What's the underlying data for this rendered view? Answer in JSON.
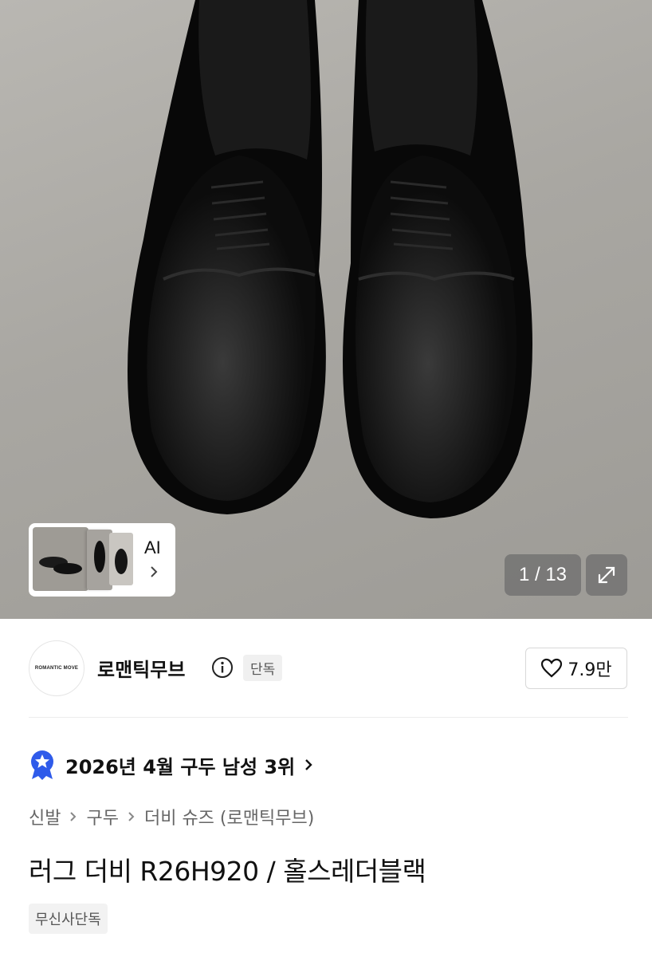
{
  "gallery": {
    "counter_current": "1",
    "counter_sep": " / ",
    "counter_total": "13",
    "ai_label": "AI"
  },
  "brand": {
    "logo_text": "ROMANTIC MOVE",
    "name": "로맨틱무브",
    "exclusive_badge": "단독",
    "like_count": "7.9만"
  },
  "ranking": {
    "text": "2026년 4월 구두 남성 3위"
  },
  "breadcrumb": {
    "items": [
      "신발",
      "구두",
      "더비 슈즈 (로맨틱무브)"
    ]
  },
  "product": {
    "title": "러그 더비 R26H920 / 홀스레더블랙",
    "tag": "무신사단독"
  },
  "colors": {
    "rank_badge": "#2f5bea",
    "text_primary": "#111111",
    "text_secondary": "#666666"
  }
}
